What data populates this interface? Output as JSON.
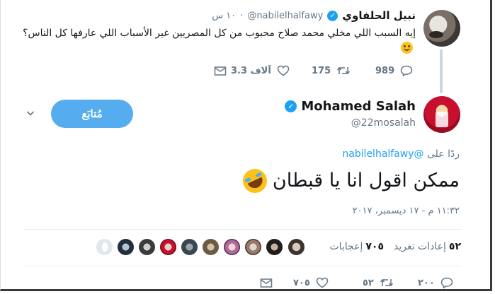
{
  "parent_tweet": {
    "name": "نبيل الحلفاوي",
    "handle": "@nabilelhalfawy",
    "time": "١٠ س",
    "text": "إيه السبب اللي مخلي محمد صلاح محبوب من كل المصريين غير الأسباب اللي عارفها كل الناس؟",
    "replies": "989",
    "retweets": "175",
    "likes": "3.3 آلاف"
  },
  "main_tweet": {
    "name": "Mohamed Salah",
    "handle": "@22mosalah",
    "follow_label": "مُتابَع",
    "reply_prefix": "ردًا على",
    "reply_mention": "@nabilelhalfawy",
    "text": "ممكن اقول انا يا قبطان",
    "timestamp": "١١:٣٢ م - ١٧ ديسمبر، ٢٠١٧",
    "retweets_count": "٥٢",
    "retweets_label": "إعادات تغريد",
    "likes_count": "٧٠٥",
    "likes_label": "إعجابات",
    "action_replies": "٢٠٠",
    "action_retweets": "٥٢",
    "action_likes": "٧٠٥"
  },
  "icons": {
    "reply": "reply-icon",
    "retweet": "retweet-icon",
    "like": "heart-icon",
    "dm": "envelope-icon",
    "verified": "verified-badge-icon",
    "more": "chevron-down-icon"
  },
  "colors": {
    "accent": "#1da1f2",
    "follow_button": "#55acee",
    "muted": "#657786",
    "text": "#14171a"
  }
}
